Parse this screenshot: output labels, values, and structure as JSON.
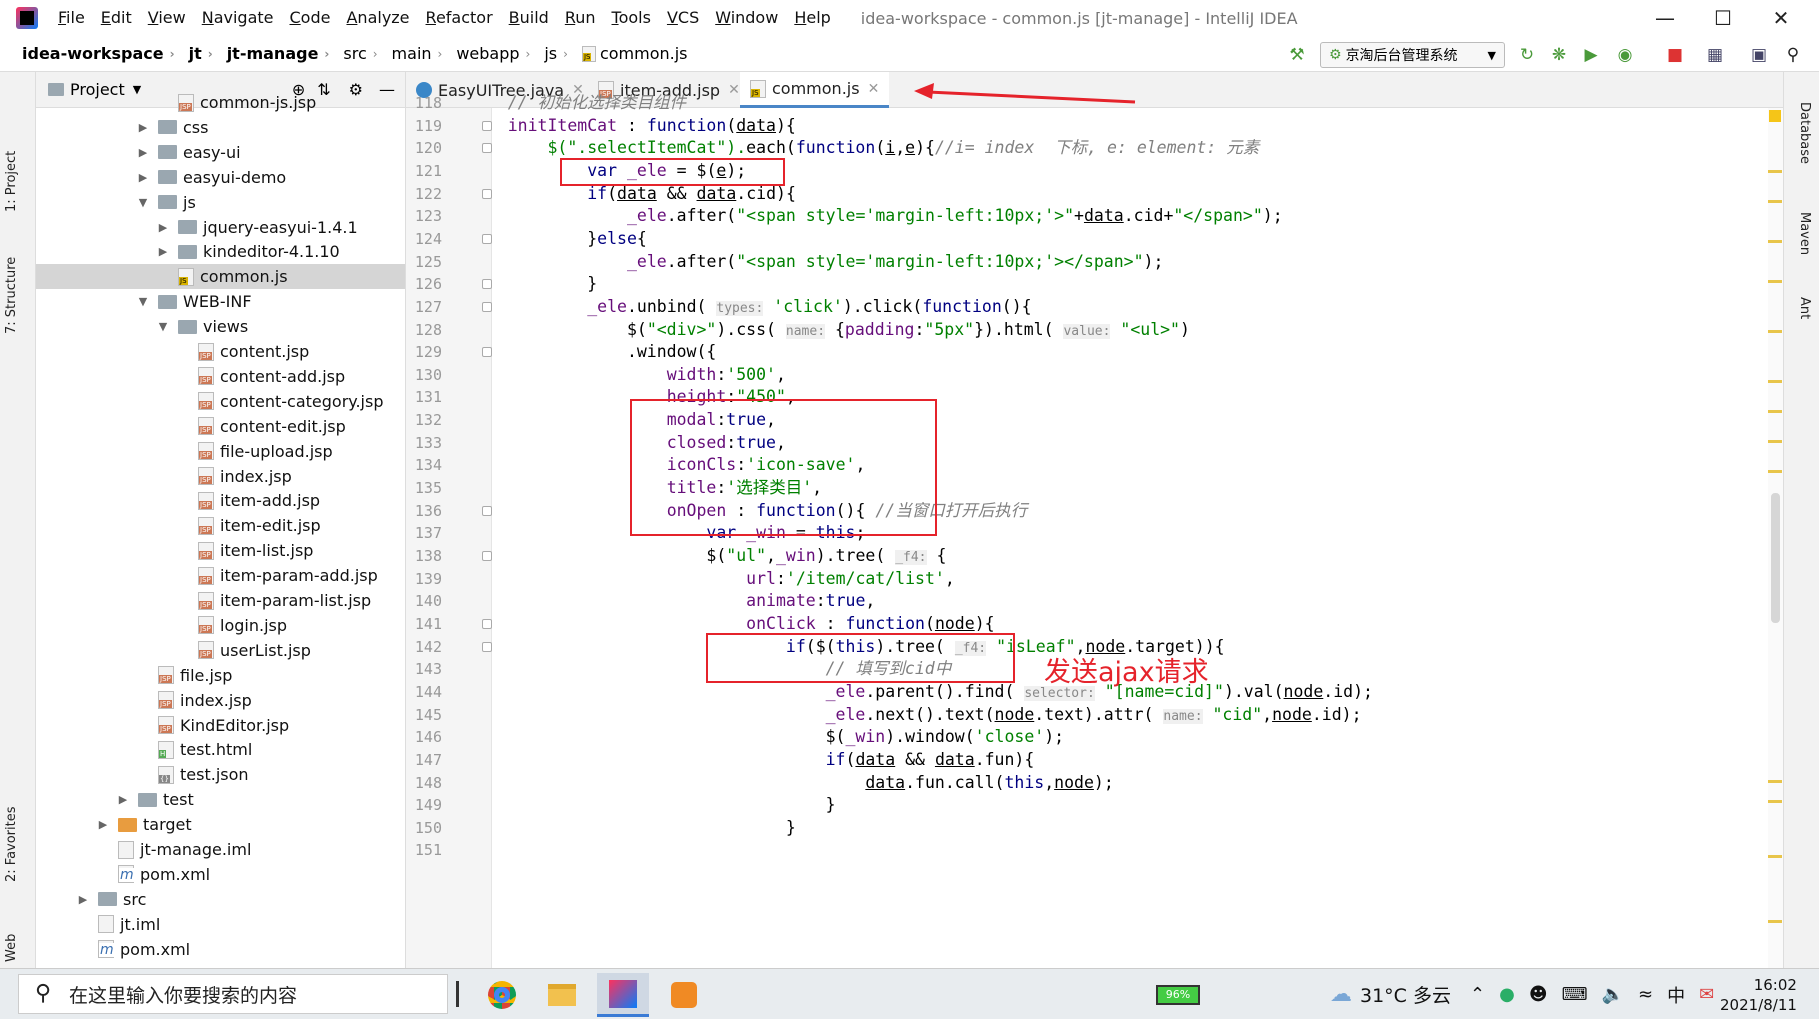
{
  "menubar": {
    "items": [
      "File",
      "Edit",
      "View",
      "Navigate",
      "Code",
      "Analyze",
      "Refactor",
      "Build",
      "Run",
      "Tools",
      "VCS",
      "Window",
      "Help"
    ],
    "window_title": "idea-workspace - common.js [jt-manage] - IntelliJ IDEA"
  },
  "navbar": {
    "breadcrumbs": [
      "idea-workspace",
      "jt",
      "jt-manage",
      "src",
      "main",
      "webapp",
      "js",
      "common.js"
    ],
    "run_config": "京淘后台管理系统"
  },
  "left_strip": {
    "tabs": [
      "1: Project",
      "7: Structure",
      "2: Favorites",
      "Web"
    ]
  },
  "right_strip": {
    "tabs": [
      "Database",
      "Maven",
      "Ant"
    ]
  },
  "project_panel": {
    "title": "Project",
    "tree": [
      {
        "label": "common-js.jsp",
        "type": "jsp",
        "depth": 4
      },
      {
        "label": "css",
        "type": "folder",
        "depth": 3,
        "arrow": "right"
      },
      {
        "label": "easy-ui",
        "type": "folder",
        "depth": 3,
        "arrow": "right"
      },
      {
        "label": "easyui-demo",
        "type": "folder",
        "depth": 3,
        "arrow": "right"
      },
      {
        "label": "js",
        "type": "folder",
        "depth": 3,
        "arrow": "down"
      },
      {
        "label": "jquery-easyui-1.4.1",
        "type": "folder",
        "depth": 4,
        "arrow": "right"
      },
      {
        "label": "kindeditor-4.1.10",
        "type": "folder",
        "depth": 4,
        "arrow": "right"
      },
      {
        "label": "common.js",
        "type": "js",
        "depth": 4,
        "selected": true
      },
      {
        "label": "WEB-INF",
        "type": "folder",
        "depth": 3,
        "arrow": "down"
      },
      {
        "label": "views",
        "type": "folder",
        "depth": 4,
        "arrow": "down"
      },
      {
        "label": "content.jsp",
        "type": "jsp",
        "depth": 5
      },
      {
        "label": "content-add.jsp",
        "type": "jsp",
        "depth": 5
      },
      {
        "label": "content-category.jsp",
        "type": "jsp",
        "depth": 5
      },
      {
        "label": "content-edit.jsp",
        "type": "jsp",
        "depth": 5
      },
      {
        "label": "file-upload.jsp",
        "type": "jsp",
        "depth": 5
      },
      {
        "label": "index.jsp",
        "type": "jsp",
        "depth": 5
      },
      {
        "label": "item-add.jsp",
        "type": "jsp",
        "depth": 5
      },
      {
        "label": "item-edit.jsp",
        "type": "jsp",
        "depth": 5
      },
      {
        "label": "item-list.jsp",
        "type": "jsp",
        "depth": 5
      },
      {
        "label": "item-param-add.jsp",
        "type": "jsp",
        "depth": 5
      },
      {
        "label": "item-param-list.jsp",
        "type": "jsp",
        "depth": 5
      },
      {
        "label": "login.jsp",
        "type": "jsp",
        "depth": 5
      },
      {
        "label": "userList.jsp",
        "type": "jsp",
        "depth": 5
      },
      {
        "label": "file.jsp",
        "type": "jsp",
        "depth": 3
      },
      {
        "label": "index.jsp",
        "type": "jsp",
        "depth": 3
      },
      {
        "label": "KindEditor.jsp",
        "type": "jsp",
        "depth": 3
      },
      {
        "label": "test.html",
        "type": "html",
        "depth": 3
      },
      {
        "label": "test.json",
        "type": "json",
        "depth": 3
      },
      {
        "label": "test",
        "type": "folder",
        "depth": 2,
        "arrow": "right"
      },
      {
        "label": "target",
        "type": "folder-orange",
        "depth": 1,
        "arrow": "right"
      },
      {
        "label": "jt-manage.iml",
        "type": "iml",
        "depth": 1
      },
      {
        "label": "pom.xml",
        "type": "xml",
        "depth": 1
      },
      {
        "label": "src",
        "type": "folder",
        "depth": 0,
        "arrow": "right"
      },
      {
        "label": "jt.iml",
        "type": "iml",
        "depth": 0
      },
      {
        "label": "pom.xml",
        "type": "xml",
        "depth": 0
      }
    ]
  },
  "editor": {
    "tabs": [
      {
        "label": "EasyUITree.java",
        "active": false
      },
      {
        "label": "item-add.jsp",
        "active": false
      },
      {
        "label": "common.js",
        "active": true
      }
    ],
    "first_line_number": 118,
    "lines": [
      [
        [
          "    // 初始化选择类目组件",
          "c"
        ]
      ],
      [
        [
          "    initItemCat",
          "f"
        ],
        [
          " : ",
          "p"
        ],
        [
          "function",
          "k"
        ],
        [
          "(",
          "p"
        ],
        [
          "data",
          "u"
        ],
        [
          "){",
          "p"
        ]
      ],
      [
        [
          "        $(\".selectItemCat\").",
          "s"
        ],
        [
          "each(",
          "p"
        ],
        [
          "function",
          "k"
        ],
        [
          "(",
          "p"
        ],
        [
          "i",
          "u"
        ],
        [
          ",",
          "p"
        ],
        [
          "e",
          "u"
        ],
        [
          "){",
          "p"
        ],
        [
          "//i= index  下标, e: element: 元素",
          "c"
        ]
      ],
      [
        [
          "            ",
          "p"
        ],
        [
          "var",
          "k"
        ],
        [
          " _ele",
          "f"
        ],
        [
          " = $(",
          "p"
        ],
        [
          "e",
          "u"
        ],
        [
          ");",
          "p"
        ]
      ],
      [
        [
          "            ",
          "p"
        ],
        [
          "if",
          "k"
        ],
        [
          "(",
          "p"
        ],
        [
          "data",
          "u"
        ],
        [
          " && ",
          "p"
        ],
        [
          "data",
          "u"
        ],
        [
          ".cid){",
          "p"
        ]
      ],
      [
        [
          "                ",
          "p"
        ],
        [
          "_ele",
          "f"
        ],
        [
          ".after(",
          "p"
        ],
        [
          "\"<span style='margin-left:10px;'>\"",
          "s"
        ],
        [
          "+",
          "p"
        ],
        [
          "data",
          "u"
        ],
        [
          ".cid+",
          "p"
        ],
        [
          "\"</span>\"",
          "s"
        ],
        [
          ");",
          "p"
        ]
      ],
      [
        [
          "            }",
          "p"
        ],
        [
          "else",
          "k"
        ],
        [
          "{",
          "p"
        ]
      ],
      [
        [
          "                ",
          "p"
        ],
        [
          "_ele",
          "f"
        ],
        [
          ".after(",
          "p"
        ],
        [
          "\"<span style='margin-left:10px;'></span>\"",
          "s"
        ],
        [
          ");",
          "p"
        ]
      ],
      [
        [
          "            }",
          "p"
        ]
      ],
      [
        [
          "            ",
          "p"
        ],
        [
          "_ele",
          "f"
        ],
        [
          ".unbind( ",
          "p"
        ],
        [
          "types:",
          "h"
        ],
        [
          " ",
          "p"
        ],
        [
          "'click'",
          "s"
        ],
        [
          ").click(",
          "p"
        ],
        [
          "function",
          "k"
        ],
        [
          "(){",
          "p"
        ]
      ],
      [
        [
          "                $(",
          "p"
        ],
        [
          "\"<div>\"",
          "s"
        ],
        [
          ").css( ",
          "p"
        ],
        [
          "name:",
          "h"
        ],
        [
          " {",
          "p"
        ],
        [
          "padding",
          "f"
        ],
        [
          ":",
          "p"
        ],
        [
          "\"5px\"",
          "s"
        ],
        [
          "}).html( ",
          "p"
        ],
        [
          "value:",
          "h"
        ],
        [
          " ",
          "p"
        ],
        [
          "\"<ul>\"",
          "s"
        ],
        [
          ")",
          "p"
        ]
      ],
      [
        [
          "                .window({",
          "p"
        ]
      ],
      [
        [
          "                    ",
          "p"
        ],
        [
          "width",
          "f"
        ],
        [
          ":",
          "p"
        ],
        [
          "'500'",
          "s"
        ],
        [
          ",",
          "p"
        ]
      ],
      [
        [
          "                    ",
          "p"
        ],
        [
          "height",
          "f"
        ],
        [
          ":",
          "p"
        ],
        [
          "\"450\"",
          "s"
        ],
        [
          ",",
          "p"
        ]
      ],
      [
        [
          "                    ",
          "p"
        ],
        [
          "modal",
          "f"
        ],
        [
          ":",
          "p"
        ],
        [
          "true",
          "k"
        ],
        [
          ",",
          "p"
        ]
      ],
      [
        [
          "                    ",
          "p"
        ],
        [
          "closed",
          "f"
        ],
        [
          ":",
          "p"
        ],
        [
          "true",
          "k"
        ],
        [
          ",",
          "p"
        ]
      ],
      [
        [
          "                    ",
          "p"
        ],
        [
          "iconCls",
          "f"
        ],
        [
          ":",
          "p"
        ],
        [
          "'icon-save'",
          "s"
        ],
        [
          ",",
          "p"
        ]
      ],
      [
        [
          "                    ",
          "p"
        ],
        [
          "title",
          "f"
        ],
        [
          ":",
          "p"
        ],
        [
          "'选择类目'",
          "s"
        ],
        [
          ",",
          "p"
        ]
      ],
      [
        [
          "                    ",
          "p"
        ],
        [
          "onOpen",
          "f"
        ],
        [
          " : ",
          "p"
        ],
        [
          "function",
          "k"
        ],
        [
          "(){ ",
          "p"
        ],
        [
          "//当窗口打开后执行",
          "c"
        ]
      ],
      [
        [
          "                        ",
          "p"
        ],
        [
          "var",
          "k"
        ],
        [
          " _win",
          "f"
        ],
        [
          " = ",
          "p"
        ],
        [
          "this",
          "k"
        ],
        [
          ";",
          "p"
        ]
      ],
      [
        [
          "                        $(",
          "p"
        ],
        [
          "\"ul\"",
          "s"
        ],
        [
          ",",
          "p"
        ],
        [
          "_win",
          "f"
        ],
        [
          ").tree( ",
          "p"
        ],
        [
          "_f4:",
          "h"
        ],
        [
          " {",
          "p"
        ]
      ],
      [
        [
          "                            ",
          "p"
        ],
        [
          "url",
          "f"
        ],
        [
          ":",
          "p"
        ],
        [
          "'/item/cat/list'",
          "s"
        ],
        [
          ",",
          "p"
        ]
      ],
      [
        [
          "                            ",
          "p"
        ],
        [
          "animate",
          "f"
        ],
        [
          ":",
          "p"
        ],
        [
          "true",
          "k"
        ],
        [
          ",",
          "p"
        ]
      ],
      [
        [
          "                            ",
          "p"
        ],
        [
          "onClick",
          "f"
        ],
        [
          " : ",
          "p"
        ],
        [
          "function",
          "k"
        ],
        [
          "(",
          "p"
        ],
        [
          "node",
          "u"
        ],
        [
          "){",
          "p"
        ]
      ],
      [
        [
          "                                ",
          "p"
        ],
        [
          "if",
          "k"
        ],
        [
          "($(",
          "p"
        ],
        [
          "this",
          "k"
        ],
        [
          ").tree( ",
          "p"
        ],
        [
          "_f4:",
          "h"
        ],
        [
          " ",
          "p"
        ],
        [
          "\"isLeaf\"",
          "s"
        ],
        [
          ",",
          "p"
        ],
        [
          "node",
          "u"
        ],
        [
          ".target)){",
          "p"
        ]
      ],
      [
        [
          "                                    // 填写到cid中",
          "c"
        ]
      ],
      [
        [
          "                                    ",
          "p"
        ],
        [
          "_ele",
          "f"
        ],
        [
          ".parent().find( ",
          "p"
        ],
        [
          "selector:",
          "h"
        ],
        [
          " ",
          "p"
        ],
        [
          "\"[name=cid]\"",
          "s"
        ],
        [
          ").val(",
          "p"
        ],
        [
          "node",
          "u"
        ],
        [
          ".id);",
          "p"
        ]
      ],
      [
        [
          "                                    ",
          "p"
        ],
        [
          "_ele",
          "f"
        ],
        [
          ".next().text(",
          "p"
        ],
        [
          "node",
          "u"
        ],
        [
          ".text).attr( ",
          "p"
        ],
        [
          "name:",
          "h"
        ],
        [
          " ",
          "p"
        ],
        [
          "\"cid\"",
          "s"
        ],
        [
          ",",
          "p"
        ],
        [
          "node",
          "u"
        ],
        [
          ".id);",
          "p"
        ]
      ],
      [
        [
          "                                    $(",
          "p"
        ],
        [
          "_win",
          "f"
        ],
        [
          ").window(",
          "p"
        ],
        [
          "'close'",
          "s"
        ],
        [
          ");",
          "p"
        ]
      ],
      [
        [
          "                                    ",
          "p"
        ],
        [
          "if",
          "k"
        ],
        [
          "(",
          "p"
        ],
        [
          "data",
          "u"
        ],
        [
          " && ",
          "p"
        ],
        [
          "data",
          "u"
        ],
        [
          ".fun){",
          "p"
        ]
      ],
      [
        [
          "                                        ",
          "p"
        ],
        [
          "data",
          "u"
        ],
        [
          ".fun.call(",
          "p"
        ],
        [
          "this",
          "k"
        ],
        [
          ",",
          "p"
        ],
        [
          "node",
          "u"
        ],
        [
          ");",
          "p"
        ]
      ],
      [
        [
          "                                    }",
          "p"
        ]
      ],
      [
        [
          "                                }",
          "p"
        ]
      ]
    ]
  },
  "annotation": {
    "text": "发送ajax请求"
  },
  "taskbar": {
    "search_placeholder": "在这里输入你要搜索的内容",
    "battery": "96%",
    "weather": "31°C 多云",
    "time": "16:02",
    "date": "2021/8/11"
  },
  "colors": {
    "annotation_red": "#e5232b",
    "keyword": "#000080",
    "string": "#008000",
    "comment": "#808080",
    "field": "#660e7a",
    "hint": "#888888"
  }
}
